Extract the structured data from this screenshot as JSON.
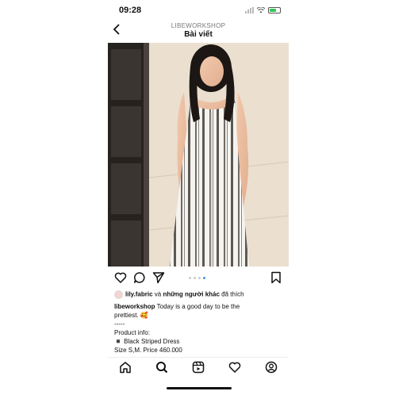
{
  "status_bar": {
    "time": "09:28"
  },
  "header": {
    "username": "LIBEWORKSHOP",
    "title": "Bài viết"
  },
  "post": {
    "likes": {
      "first_user": "lily.fabric",
      "joiner": " và ",
      "others": "những người khác",
      "suffix": " đã thích"
    },
    "caption": {
      "username": "libeworkshop",
      "text_part1": " Today is a good day to be the",
      "text_part2": "prettiest. 🥰",
      "separator": "-----",
      "product_info": "Product info:",
      "product_name": "◾ Black Striped Dress",
      "size_price": "Size S,M. Price 460.000"
    },
    "carousel": {
      "count": 4,
      "active_index": 3
    }
  },
  "icons": {
    "back": "chevron-left-icon",
    "like": "heart-icon",
    "comment": "comment-icon",
    "share": "send-icon",
    "save": "bookmark-icon",
    "nav": [
      "home-icon",
      "search-icon",
      "reels-icon",
      "heart-icon",
      "profile-icon"
    ]
  },
  "colors": {
    "accent": "#3897f0",
    "battery": "#34c759"
  }
}
